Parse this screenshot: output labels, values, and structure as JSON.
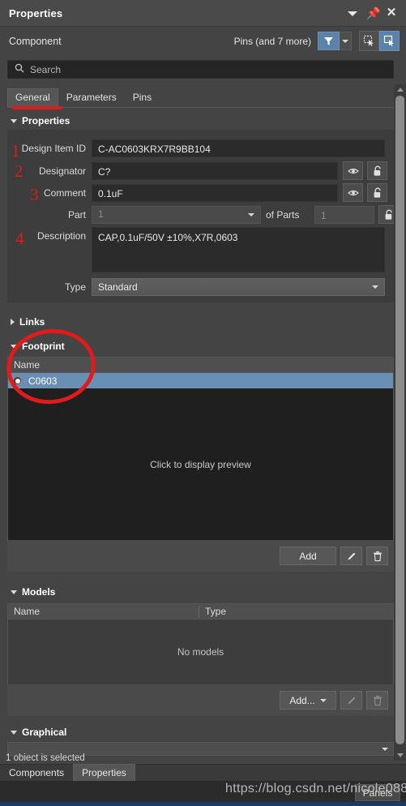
{
  "titlebar": {
    "title": "Properties",
    "icons": [
      "caret-down-icon",
      "pin-icon",
      "close-icon"
    ]
  },
  "component_bar": {
    "label": "Component",
    "scope": "Pins (and 7 more)",
    "filter_button": "filter-funnel-icon",
    "filter_dropdown": "chevron-down-icon",
    "select_mode_1": "select-object-icon",
    "select_mode_2": "select-active-icon"
  },
  "search": {
    "placeholder": "Search",
    "value": "",
    "icon": "search-icon"
  },
  "tabs": [
    {
      "label": "General",
      "active": true
    },
    {
      "label": "Parameters",
      "active": false
    },
    {
      "label": "Pins",
      "active": false
    }
  ],
  "sections": {
    "properties": {
      "label": "Properties",
      "expanded": true
    },
    "links": {
      "label": "Links",
      "expanded": false
    },
    "footprint": {
      "label": "Footprint",
      "expanded": true
    },
    "models": {
      "label": "Models",
      "expanded": true
    },
    "graphical": {
      "label": "Graphical",
      "expanded": true
    }
  },
  "properties": {
    "design_item_id": {
      "label": "Design Item ID",
      "value": "C-AC0603KRX7R9BB104"
    },
    "designator": {
      "label": "Designator",
      "value": "C?",
      "visibility_icon": "eye-icon",
      "lock_icon": "unlock-icon"
    },
    "comment": {
      "label": "Comment",
      "value": "0.1uF",
      "visibility_icon": "eye-icon",
      "lock_icon": "unlock-icon"
    },
    "part": {
      "label": "Part",
      "value": "1",
      "of_parts_label": "of Parts",
      "of_parts_value": "1",
      "lock_icon": "unlock-icon"
    },
    "description": {
      "label": "Description",
      "value": "CAP,0.1uF/50V ±10%,X7R,0603"
    },
    "type": {
      "label": "Type",
      "value": "Standard"
    }
  },
  "footprint": {
    "columns": [
      "Name"
    ],
    "rows": [
      {
        "name": "C0603",
        "selected": true
      }
    ],
    "preview_text": "Click to display preview",
    "buttons": {
      "add": "Add",
      "edit": "edit-pencil-icon",
      "delete": "trash-icon"
    }
  },
  "models": {
    "columns": [
      "Name",
      "Type"
    ],
    "rows": [],
    "empty_text": "No models",
    "buttons": {
      "add": "Add...",
      "add_caret": "chevron-down-icon",
      "edit": "edit-pencil-icon",
      "delete": "trash-icon"
    }
  },
  "graphical": {
    "value": ""
  },
  "status": {
    "text": "1 obiect is selected"
  },
  "bottom_tabs": [
    {
      "label": "Components",
      "active": false
    },
    {
      "label": "Properties",
      "active": true
    }
  ],
  "panels_button": {
    "label": "Panels"
  },
  "watermark": {
    "text": "https://blog.csdn.net/nicole088"
  },
  "annotations": {
    "numbers": [
      "1",
      "2",
      "3",
      "4"
    ],
    "accent_color": "#e01b1b",
    "circle_target": "Footprint"
  },
  "colors": {
    "panel_bg": "#444444",
    "input_bg": "#2b2b2b",
    "accent_blue": "#5b82a8",
    "selection_blue": "#6a8fb5",
    "annotation_red": "#e01b1b"
  }
}
